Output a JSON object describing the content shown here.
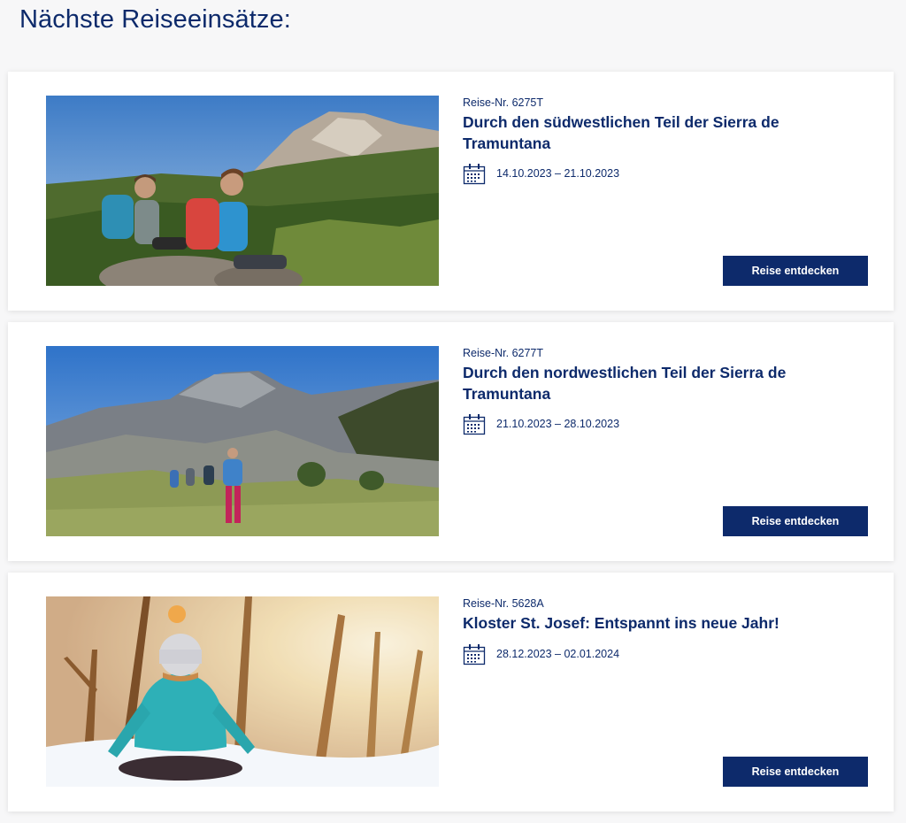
{
  "page": {
    "title": "Nächste Reiseeinsätze:"
  },
  "trips": [
    {
      "number": "Reise-Nr. 6275T",
      "title": "Durch den südwestlichen Teil der Sierra de Tramuntana",
      "dates": "14.10.2023 – 21.10.2023",
      "button_label": "Reise entdecken",
      "image": "photo-hikers-resting-mountain"
    },
    {
      "number": "Reise-Nr. 6277T",
      "title": "Durch den nordwestlichen Teil der Sierra de Tramuntana",
      "dates": "21.10.2023 – 28.10.2023",
      "button_label": "Reise entdecken",
      "image": "photo-hikers-rocky-trail"
    },
    {
      "number": "Reise-Nr. 5628A",
      "title": "Kloster St. Josef: Entspannt ins neue Jahr!",
      "dates": "28.12.2023 – 02.01.2024",
      "button_label": "Reise entdecken",
      "image": "photo-meditation-snow"
    }
  ],
  "icons": {
    "date": "calendar-icon"
  },
  "colors": {
    "brand": "#0d2a6b",
    "card_bg": "#ffffff",
    "page_bg": "#f7f7f8"
  }
}
